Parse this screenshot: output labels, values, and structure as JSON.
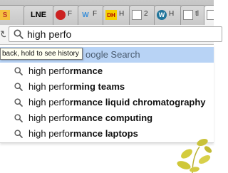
{
  "tabs": [
    {
      "favicon_text": "S",
      "title": "",
      "favicon_bg": "#c0392b",
      "favicon_fg": "#ffffff"
    },
    {
      "favicon_text": "LNE",
      "title": "",
      "favicon_bg": "#ffffff",
      "favicon_fg": "#000000"
    },
    {
      "favicon_text": "",
      "title": "F",
      "favicon_bg": "#cc2222",
      "favicon_fg": "#ffffff"
    },
    {
      "favicon_text": "W",
      "title": "F",
      "favicon_bg": "#ffffff",
      "favicon_fg": "#3b8fd9"
    },
    {
      "favicon_text": "DH",
      "title": "H",
      "favicon_bg": "#f5d000",
      "favicon_fg": "#b00000"
    },
    {
      "favicon_text": "",
      "title": "2",
      "favicon_bg": "#e8e8e8",
      "favicon_fg": "#555555"
    },
    {
      "favicon_text": "W",
      "title": "H",
      "favicon_bg": "#21759b",
      "favicon_fg": "#ffffff"
    },
    {
      "favicon_text": "",
      "title": "tl",
      "favicon_bg": "#e8e8e8",
      "favicon_fg": "#555555"
    },
    {
      "favicon_text": "",
      "title": "",
      "favicon_bg": "#e8e8e8",
      "favicon_fg": "#555555"
    }
  ],
  "omnibox": {
    "value": "high perfo",
    "icon": "search-icon"
  },
  "tooltip": "back, hold to see history",
  "suggestions": [
    {
      "typed": "",
      "completion": "oogle Search",
      "selected": true
    },
    {
      "typed": "high perfo",
      "completion": "rmance",
      "selected": false
    },
    {
      "typed": "high perfo",
      "completion": "rming teams",
      "selected": false
    },
    {
      "typed": "high perfo",
      "completion": "rmance liquid chromatography",
      "selected": false
    },
    {
      "typed": "high perfo",
      "completion": "rmance computing",
      "selected": false
    },
    {
      "typed": "high perfo",
      "completion": "rmance laptops",
      "selected": false
    }
  ],
  "colors": {
    "selected_row": "#b8d3f5",
    "plant": "#c9c23a"
  }
}
